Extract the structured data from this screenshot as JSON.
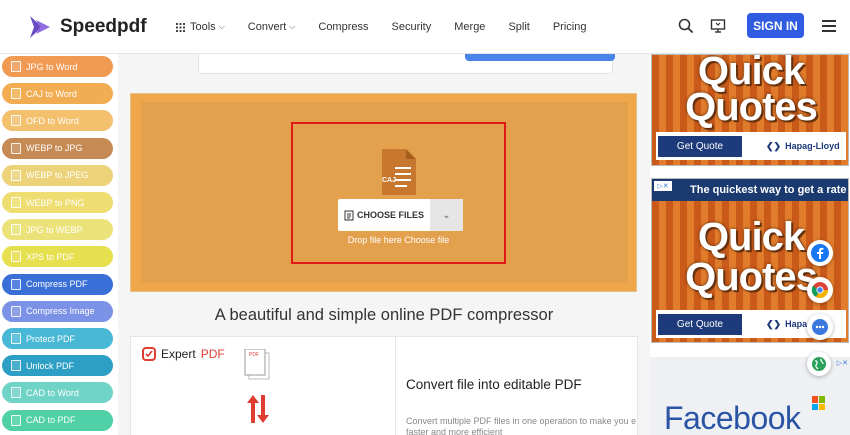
{
  "header": {
    "brand": "Speedpdf",
    "nav": [
      {
        "label": "Tools",
        "has_menu": true
      },
      {
        "label": "Convert",
        "has_menu": true
      },
      {
        "label": "Compress"
      },
      {
        "label": "Security"
      },
      {
        "label": "Merge"
      },
      {
        "label": "Split"
      },
      {
        "label": "Pricing"
      }
    ],
    "signin_label": "SIGN IN",
    "icons": [
      "search-icon",
      "desktop-icon",
      "hamburger-menu-icon"
    ]
  },
  "sidebar": {
    "items": [
      {
        "label": "JPG to Word",
        "color": "#f09a54"
      },
      {
        "label": "CAJ to Word",
        "color": "#f2ad52"
      },
      {
        "label": "OFD to Word",
        "color": "#f3c06e"
      },
      {
        "label": "WEBP to JPG",
        "color": "#c68a55"
      },
      {
        "label": "WEBP to JPEG",
        "color": "#ecd37a"
      },
      {
        "label": "WEBP to PNG",
        "color": "#eedd70"
      },
      {
        "label": "JPG to WEBP",
        "color": "#ece27a"
      },
      {
        "label": "XPS to PDF",
        "color": "#e6e04e"
      },
      {
        "label": "Compress PDF",
        "color": "#3a6fd8"
      },
      {
        "label": "Compress Image",
        "color": "#7b92e6"
      },
      {
        "label": "Protect PDF",
        "color": "#49b8d6"
      },
      {
        "label": "Unlock PDF",
        "color": "#2e9fc4"
      },
      {
        "label": "CAD to Word",
        "color": "#6fd3c7"
      },
      {
        "label": "CAD to PDF",
        "color": "#4fd0a6"
      }
    ]
  },
  "upload": {
    "file_label": "CAJ",
    "choose_label": "CHOOSE FILES",
    "drop_text": "Drop file here Choose file",
    "accent": "#e01818"
  },
  "tagline": "A beautiful and simple online PDF compressor",
  "promo": {
    "brand_prefix": "Expert",
    "brand_suffix": "PDF",
    "file_badge": "PDF",
    "title": "Convert file into editable PDF",
    "description": "Convert multiple PDF files in one operation to make you e faster and more efficient"
  },
  "ads": {
    "quote_word1": "Quick",
    "quote_word2": "Quotes",
    "cta": "Get Quote",
    "brand": "Hapag-Lloyd",
    "brand_short": "Hapag",
    "headline": "The quickest way to get a rate",
    "facebook": "Facebook"
  }
}
